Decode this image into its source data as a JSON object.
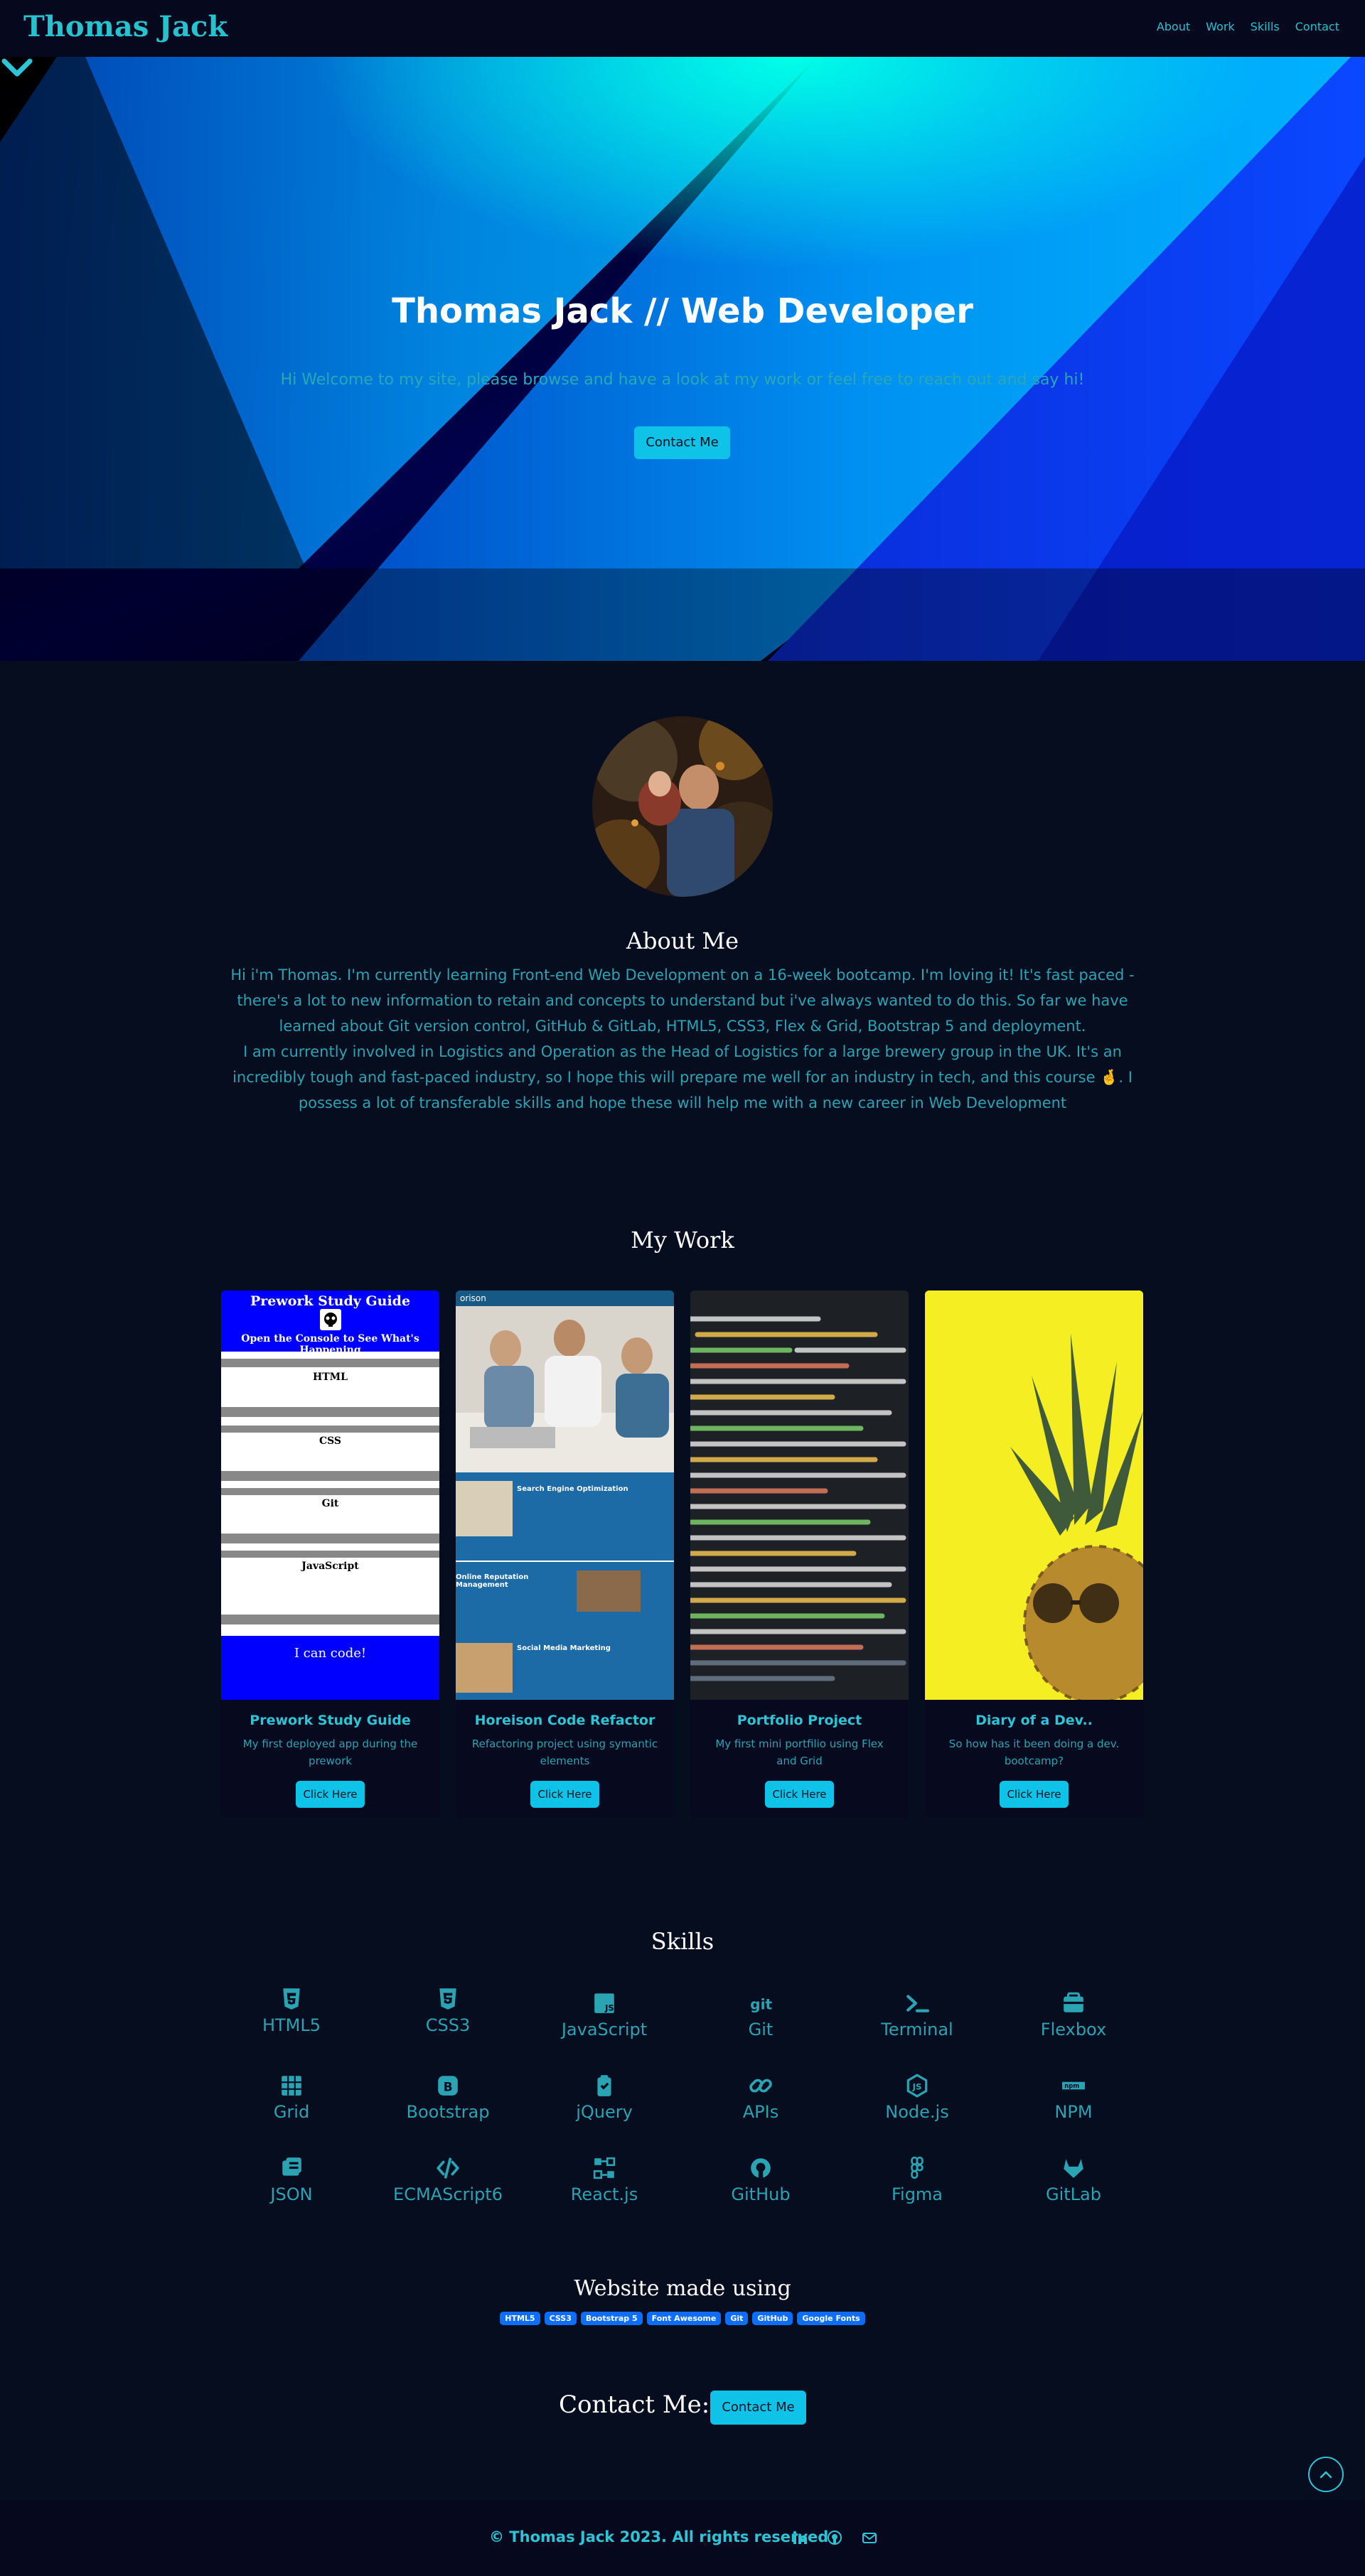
{
  "nav": {
    "brand": "Thomas Jack",
    "links": [
      "About",
      "Work",
      "Skills",
      "Contact"
    ]
  },
  "hero": {
    "title": "Thomas Jack // Web Developer",
    "subtitle": "Hi Welcome to my site, please browse and have a look at my work or feel free to reach out and say hi!",
    "button": "Contact Me"
  },
  "about": {
    "heading": "About Me",
    "paragraph1": "Hi i'm Thomas. I'm currently learning Front-end Web Development on a 16-week bootcamp. I'm loving it! It's fast paced - there's a lot to new information to retain and concepts to understand but i've always wanted to do this. So far we have learned about Git version control, GitHub & GitLab, HTML5, CSS3, Flex & Grid, Bootstrap 5 and deployment.",
    "paragraph2": "I am currently involved in Logistics and Operation as the Head of Logistics for a large brewery group in the UK. It's an incredibly tough and fast-paced industry, so I hope this will prepare me well for an industry in tech, and this course 🤞. I possess a lot of transferable skills and hope these will help me with a new career in Web Development"
  },
  "work": {
    "heading": "My Work",
    "cards": [
      {
        "title": "Prework Study Guide",
        "text": "My first deployed app during the prework",
        "button": "Click Here",
        "thumb": {
          "heading": "Prework Study Guide",
          "subheading": "Open the Console to See What's Happening",
          "sections": [
            "HTML",
            "CSS",
            "Git",
            "JavaScript"
          ],
          "footer": "I can code!"
        }
      },
      {
        "title": "Horeison Code Refactor",
        "text": "Refactoring project using symantic elements",
        "button": "Click Here",
        "thumb": {
          "brand": "orison",
          "panels": [
            "Search Engine Optimization",
            "Online Reputation Management",
            "Social Media Marketing"
          ]
        }
      },
      {
        "title": "Portfolio Project",
        "text": "My first mini portfilio using Flex and Grid",
        "button": "Click Here"
      },
      {
        "title": "Diary of a Dev..",
        "text": "So how has it been doing a dev. bootcamp?",
        "button": "Click Here"
      }
    ]
  },
  "skills": {
    "heading": "Skills",
    "items": [
      "HTML5",
      "CSS3",
      "JavaScript",
      "Git",
      "Terminal",
      "Flexbox",
      "Grid",
      "Bootstrap",
      "jQuery",
      "APIs",
      "Node.js",
      "NPM",
      "JSON",
      "ECMAScript6",
      "React.js",
      "GitHub",
      "Figma",
      "GitLab"
    ],
    "icons": [
      "html5-icon",
      "css3-icon",
      "javascript-icon",
      "git-icon",
      "terminal-icon",
      "flexbox-icon",
      "grid-icon",
      "bootstrap-icon",
      "jquery-icon",
      "link-icon",
      "nodejs-icon",
      "npm-icon",
      "json-icon",
      "code-icon",
      "react-icon",
      "github-icon",
      "figma-icon",
      "gitlab-icon"
    ]
  },
  "made_using": {
    "heading": "Website made using",
    "badges": [
      "HTML5",
      "CSS3",
      "Bootstrap 5",
      "Font Awesome",
      "Git",
      "GitHub",
      "Google Fonts"
    ]
  },
  "contact": {
    "label": "Contact Me:",
    "button": "Contact Me"
  },
  "footer": {
    "copyright": "© Thomas Jack 2023. All rights reserved",
    "icons": [
      "linkedin-icon",
      "github-icon",
      "email-icon"
    ]
  },
  "colors": {
    "background": "#050d1f",
    "navbar": "#06091e",
    "accent": "#2ec4d6",
    "button": "#0ec2e8",
    "badge": "#0d6efd"
  }
}
